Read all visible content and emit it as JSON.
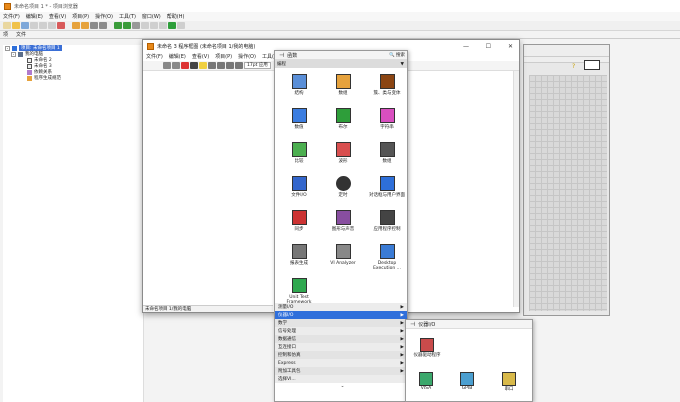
{
  "project": {
    "title": "未命名项目 1 * - 项目浏览器",
    "menu": [
      "文件(F)",
      "编辑(E)",
      "查看(V)",
      "项目(P)",
      "操作(O)",
      "工具(T)",
      "窗口(W)",
      "帮助(H)"
    ],
    "tabs": [
      "项",
      "文件"
    ],
    "tree": [
      {
        "label": "项目: 未命名项目 1",
        "level": 0,
        "selected": true,
        "expander": "-"
      },
      {
        "label": "我的电脑",
        "level": 1,
        "expander": "-"
      },
      {
        "label": "未命名 2",
        "level": 2
      },
      {
        "label": "未命名 3",
        "level": 2
      },
      {
        "label": "依赖关系",
        "level": 2
      },
      {
        "label": "程序生成规范",
        "level": 2
      }
    ]
  },
  "bd": {
    "title": "未命名 3 程序框图 (未命名项目 1/我的电脑)",
    "menu": [
      "文件(F)",
      "编辑(E)",
      "查看(V)",
      "项目(P)",
      "操作(O)",
      "工具("
    ],
    "font_select": "17pt 应用",
    "status": "未命名项目 1/我的电脑",
    "win_controls": {
      "min": "—",
      "max": "☐",
      "close": "✕"
    }
  },
  "palette": {
    "title": "函数",
    "search_label": "搜索",
    "category": "编程",
    "items": [
      {
        "label": "结构",
        "icon": "structures-icon",
        "color": "#5a8fd8"
      },
      {
        "label": "数组",
        "icon": "array-icon",
        "color": "#e6a23c"
      },
      {
        "label": "簇、类与变体",
        "icon": "cluster-icon",
        "color": "#8b4513"
      },
      {
        "label": "数值",
        "icon": "numeric-icon",
        "color": "#3b7de0"
      },
      {
        "label": "布尔",
        "icon": "boolean-icon",
        "color": "#2e9e3a"
      },
      {
        "label": "字符串",
        "icon": "string-icon",
        "color": "#d94fc0"
      },
      {
        "label": "比较",
        "icon": "comparison-icon",
        "color": "#4caf50"
      },
      {
        "label": "波形",
        "icon": "waveform-icon",
        "color": "#d94f4f"
      },
      {
        "label": "数组",
        "icon": "timing-array-icon",
        "color": "#555555"
      },
      {
        "label": "文件I/O",
        "icon": "file-io-icon",
        "color": "#3366cc"
      },
      {
        "label": "定时",
        "icon": "timer-icon",
        "color": "#333333"
      },
      {
        "label": "对话框与用户界面",
        "icon": "dialog-icon",
        "color": "#2e6fd9"
      },
      {
        "label": "同步",
        "icon": "sync-icon",
        "color": "#cc3333"
      },
      {
        "label": "图形与声音",
        "icon": "graphics-icon",
        "color": "#884ea0"
      },
      {
        "label": "应用程序控制",
        "icon": "app-control-icon",
        "color": "#444444"
      },
      {
        "label": "报表生成",
        "icon": "report-icon",
        "color": "#777777"
      },
      {
        "label": "VI Analyzer",
        "icon": "vi-analyzer-icon",
        "color": "#888888"
      },
      {
        "label": "Desktop Execution ...",
        "icon": "desktop-exec-icon",
        "color": "#3a7bd5"
      },
      {
        "label": "Unit Test Framework",
        "icon": "unit-test-icon",
        "color": "#2fa84f"
      }
    ],
    "menu": [
      {
        "label": "测量I/O",
        "arrow": "▶"
      },
      {
        "label": "仪器I/O",
        "arrow": "▶",
        "highlight": true
      },
      {
        "label": "数学",
        "arrow": "▶"
      },
      {
        "label": "信号处理",
        "arrow": "▶"
      },
      {
        "label": "数据通信",
        "arrow": "▶"
      },
      {
        "label": "互连接口",
        "arrow": "▶"
      },
      {
        "label": "控制和仿真",
        "arrow": "▶"
      },
      {
        "label": "Express",
        "arrow": "▶"
      },
      {
        "label": "附加工具包",
        "arrow": "▶"
      },
      {
        "label": "选择VI...",
        "arrow": ""
      }
    ],
    "more": "⌄"
  },
  "io": {
    "title": "仪器I/O",
    "items": [
      {
        "label": "仪器驱动程序",
        "icon": "instrument-driver-icon"
      },
      {
        "label": "VISA",
        "icon": "visa-icon"
      },
      {
        "label": "GPIB",
        "icon": "gpib-icon"
      },
      {
        "label": "串口",
        "icon": "serial-icon"
      }
    ]
  }
}
